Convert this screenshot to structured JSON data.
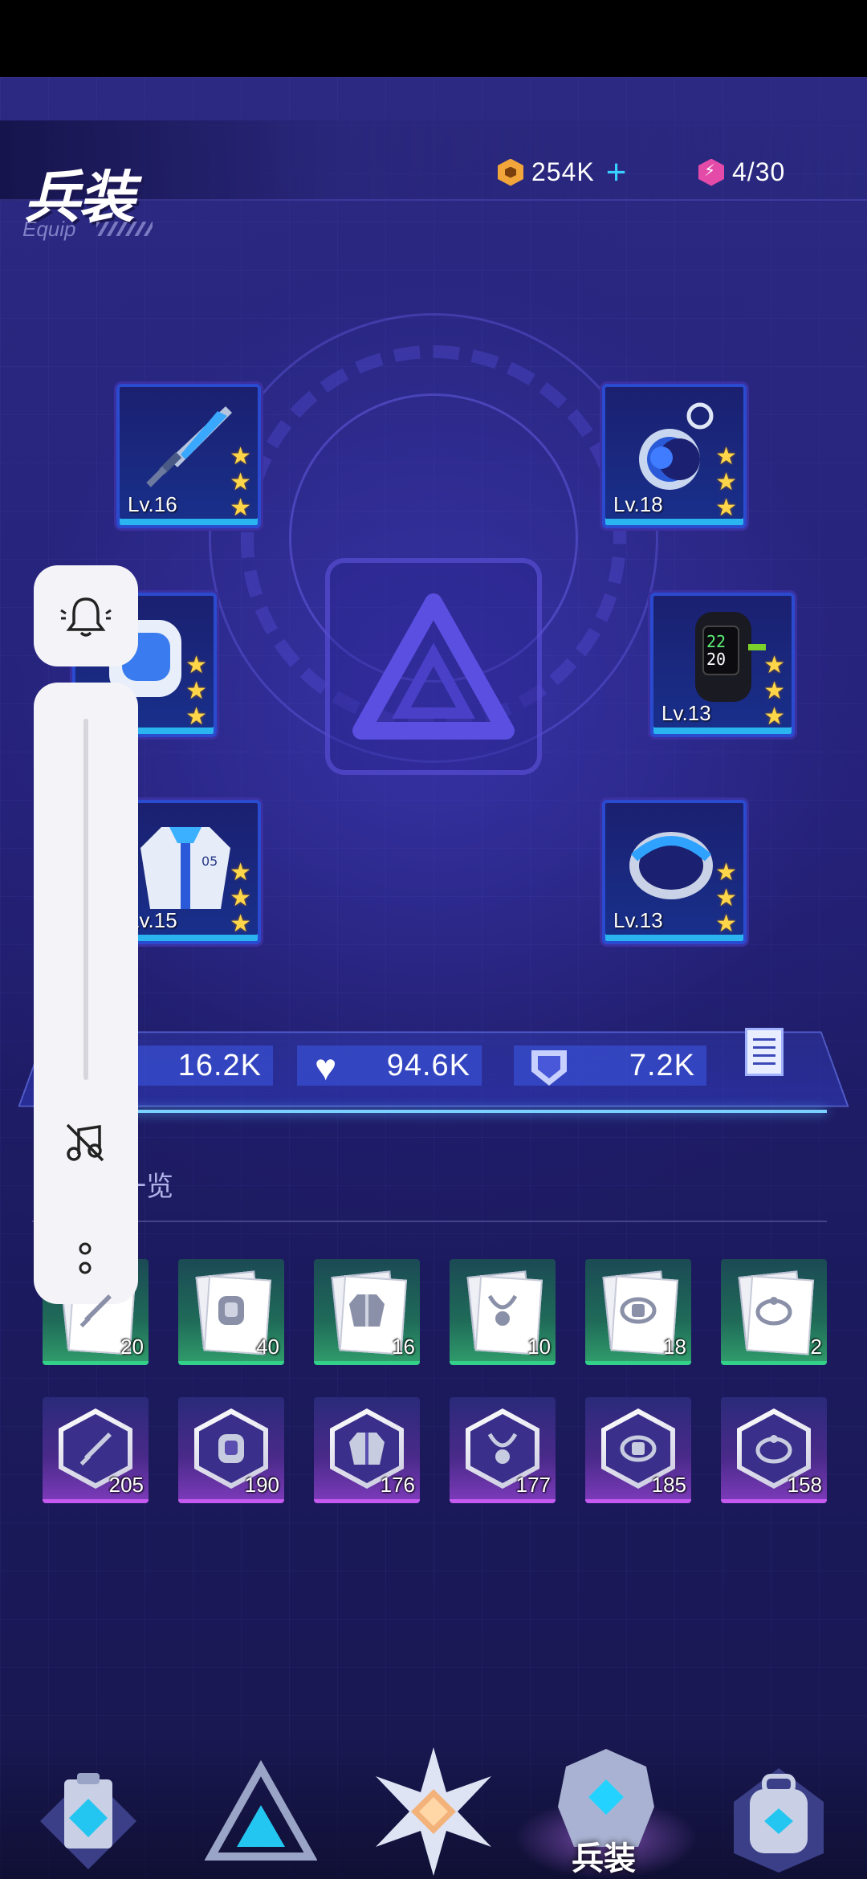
{
  "header": {
    "title": "兵装",
    "subtitle": "Equip"
  },
  "currency": {
    "gold": "254K",
    "energy": "4/30"
  },
  "equipment": [
    {
      "slot": "weapon",
      "level": "Lv.16",
      "stars": 3
    },
    {
      "slot": "pendant",
      "level": "Lv.18",
      "stars": 3
    },
    {
      "slot": "armor",
      "level": "",
      "stars": 3
    },
    {
      "slot": "watch",
      "level": "Lv.13",
      "stars": 3
    },
    {
      "slot": "jacket",
      "level": "Lv.15",
      "stars": 3
    },
    {
      "slot": "ring",
      "level": "Lv.13",
      "stars": 3
    }
  ],
  "stats": {
    "attack": "16.2K",
    "hp": "94.6K",
    "defense": "7.2K"
  },
  "materials": {
    "section_label": "素材一览",
    "green_counts": [
      "20",
      "40",
      "16",
      "10",
      "18",
      "2"
    ],
    "purple_counts": [
      "205",
      "190",
      "176",
      "177",
      "185",
      "158"
    ]
  },
  "nav": {
    "active_label": "兵装"
  },
  "colors": {
    "accent_cyan": "#38d0ff",
    "gold": "#f1a53a",
    "energy": "#e44aa8",
    "star": "#ffd54a",
    "green_rarity": "#33d08a",
    "purple_rarity": "#c45af0"
  }
}
